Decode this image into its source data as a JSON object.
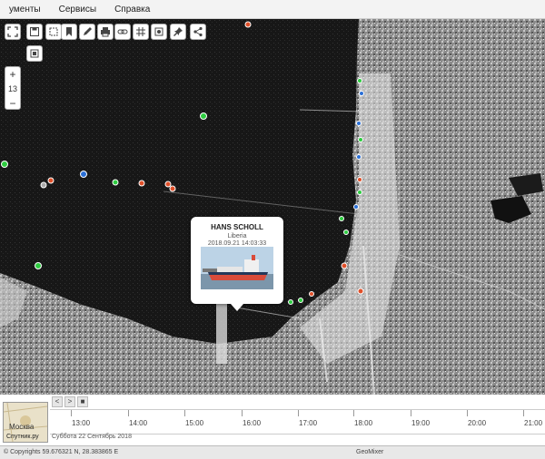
{
  "menu": {
    "items": [
      "ументы",
      "Сервисы",
      "Справка"
    ]
  },
  "map": {
    "zoom_in": "+",
    "zoom_level": "13",
    "zoom_out": "−",
    "toolbar_icons": [
      "fullscreen-icon",
      "save-icon",
      "crop-icon",
      "bookmark-icon",
      "pencil-icon",
      "print-icon",
      "link-icon",
      "grid-icon",
      "layers-icon",
      "pin-icon",
      "share-icon"
    ],
    "colors": {
      "sea": "#1a1a1a",
      "land": "#9a9a9a",
      "vessel_green": "#2ecc40",
      "vessel_red": "#e0502a",
      "vessel_blue": "#2a6fd6"
    }
  },
  "popup": {
    "vessel_name": "HANS SCHOLL",
    "flag": "Liberia",
    "timestamp": "2018.09.21 14:03:33"
  },
  "timeline": {
    "nav": [
      "<",
      ">",
      "■"
    ],
    "hours": [
      "13:00",
      "14:00",
      "15:00",
      "16:00",
      "17:00",
      "18:00",
      "19:00",
      "20:00",
      "21:00"
    ],
    "date_label": "Суббота 22 Сентябрь 2018"
  },
  "minimap": {
    "city": "Москва",
    "source": "Спутник.ру"
  },
  "footer": {
    "coords": "© Copyrights   59.676321 N, 28.383865 E",
    "brand": "GeoMixer"
  }
}
